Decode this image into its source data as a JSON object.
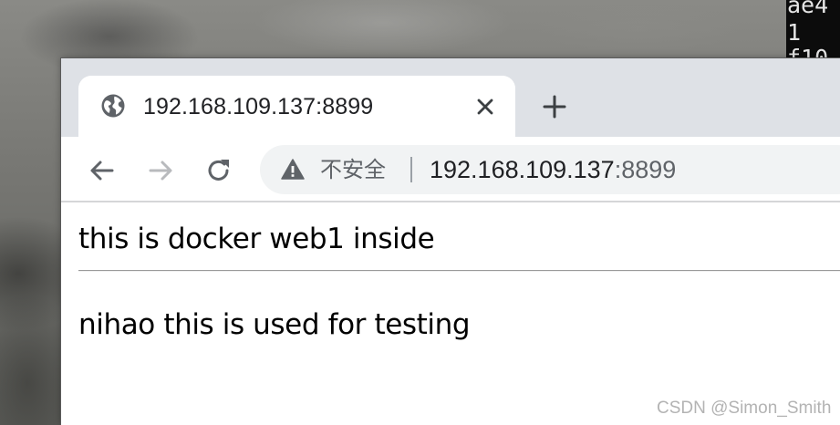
{
  "terminal": {
    "lines": [
      "ae4",
      "1",
      "f10"
    ]
  },
  "browser": {
    "tab": {
      "title": "192.168.109.137:8899",
      "icon": "globe-icon",
      "close_icon": "close-icon"
    },
    "new_tab_icon": "plus-icon",
    "nav": {
      "back_icon": "arrow-left-icon",
      "forward_icon": "arrow-right-icon",
      "reload_icon": "reload-icon"
    },
    "omnibox": {
      "security_icon": "warning-icon",
      "security_label": "不安全",
      "url_host": "192.168.109.137",
      "url_port": ":8899"
    }
  },
  "page": {
    "heading": "this is docker web1 inside",
    "paragraph": "nihao this is used for testing"
  },
  "watermark": "CSDN @Simon_Smith",
  "colors": {
    "tabstrip": "#dee1e6",
    "omnibox": "#f1f3f4",
    "icon": "#5f6368",
    "icon_disabled": "#b8babd",
    "text": "#202124"
  }
}
